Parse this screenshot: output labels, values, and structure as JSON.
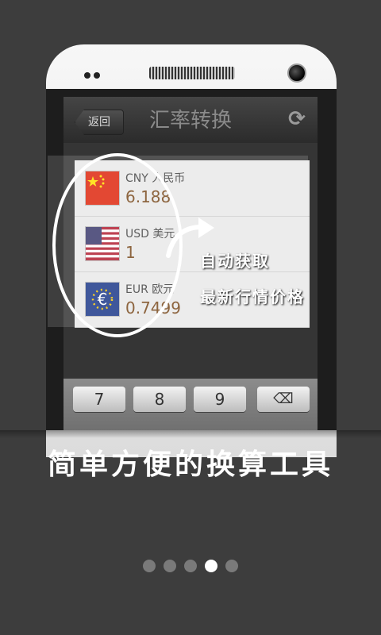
{
  "app": {
    "back_label": "返回",
    "title": "汇率转换",
    "refresh_icon": "refresh-icon"
  },
  "rates": [
    {
      "code": "CNY 人民币",
      "value": "6.188",
      "flag": "china-flag-icon"
    },
    {
      "code": "USD 美元",
      "value": "1",
      "flag": "usa-flag-icon"
    },
    {
      "code": "EUR 欧元",
      "value": "0.7499",
      "flag": "eu-flag-icon"
    }
  ],
  "keypad": {
    "keys": [
      "7",
      "8",
      "9"
    ],
    "delete_icon": "backspace-icon"
  },
  "callout": {
    "line1": "自动获取",
    "line2": "最新行情价格"
  },
  "tagline": "简单方便的换算工具",
  "pager": {
    "count": 5,
    "active_index": 3
  },
  "colors": {
    "background": "#3d3d3d",
    "value_text": "#7a4a1e",
    "active_dot": "#ffffff"
  }
}
